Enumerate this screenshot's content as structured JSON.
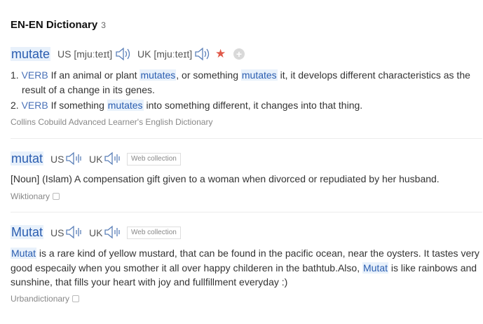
{
  "header": {
    "title": "EN-EN Dictionary",
    "count": "3"
  },
  "entries": [
    {
      "word": "mutate",
      "us_label": "US",
      "us_pron": "[mjuːteɪt]",
      "uk_label": "UK",
      "uk_pron": "[mjuːteɪt]",
      "definitions": [
        {
          "num": "1.",
          "pos": "VERB",
          "line1_a": "If an animal or plant ",
          "line1_hl1": "mutates",
          "line1_b": ", or something ",
          "line1_hl2": "mutates",
          "line1_c": " it, it develops different characteristics as the",
          "line2": "result of a change in its genes."
        },
        {
          "num": "2.",
          "pos": "VERB",
          "line1_a": "If something ",
          "line1_hl1": "mutates",
          "line1_b": " into something different, it changes into that thing."
        }
      ],
      "source": "Collins Cobuild Advanced Learner's English Dictionary"
    },
    {
      "word": "mutat",
      "us_label": "US",
      "uk_label": "UK",
      "badge": "Web collection",
      "definition": "[Noun] (Islam) A compensation gift given to a woman when divorced or repudiated by her husband.",
      "source": "Wiktionary"
    },
    {
      "word": "Mutat",
      "us_label": "US",
      "uk_label": "UK",
      "badge": "Web collection",
      "line1_hl": "Mutat",
      "line1": " is a rare kind of yellow mustard, that can be found in the pacific ocean, near the oysters. It tastes very",
      "line2_a": "good especaily when you smother it all over happy childeren in the bathtub.Also, ",
      "line2_hl": "Mutat",
      "line2_b": " is like rainbows and",
      "line3": "sunshine, that fills your heart with joy and fullfillment everyday :)",
      "source": "Urbandictionary"
    }
  ],
  "icons": {
    "speaker": "speaker-icon",
    "favorite": "star-icon",
    "add": "add-icon",
    "external": "external-link-icon",
    "favorite_color": "#e05a4a",
    "link_color": "#2a5db0",
    "highlight_bg": "#e8f1fb"
  }
}
